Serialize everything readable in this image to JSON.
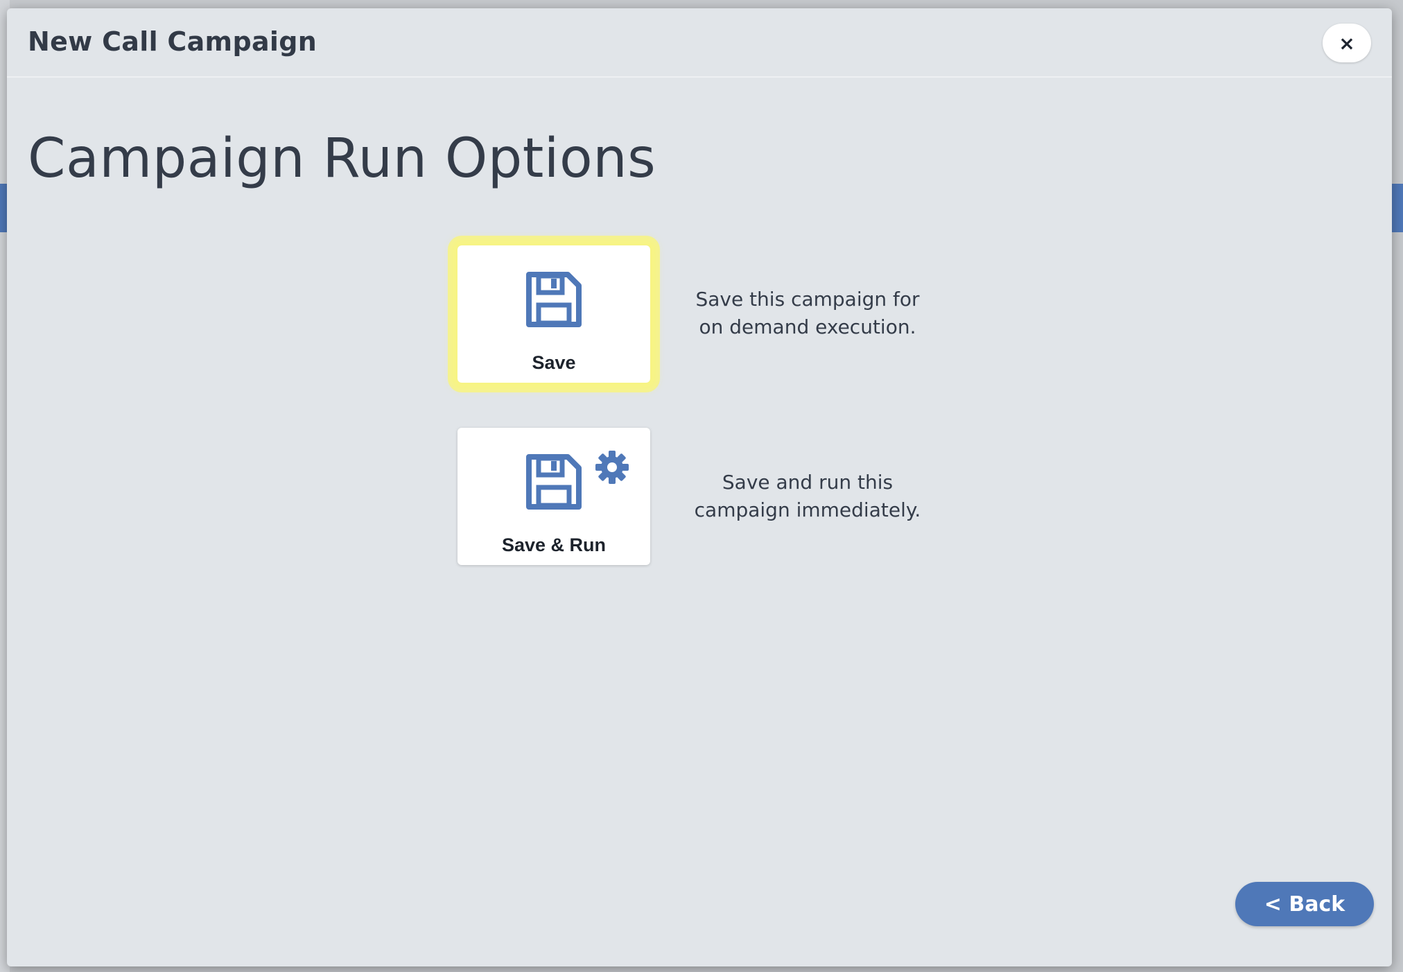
{
  "modal": {
    "title": "New Call Campaign",
    "close_label": "×"
  },
  "page": {
    "heading": "Campaign Run Options"
  },
  "options": [
    {
      "label": "Save",
      "icon": "floppy-disk-icon",
      "description_line1": "Save this campaign for",
      "description_line2": "on demand execution.",
      "highlighted": true
    },
    {
      "label": "Save & Run",
      "icon": "floppy-disk-gear-icon",
      "description_line1": "Save and run this",
      "description_line2": "campaign immediately.",
      "highlighted": false
    }
  ],
  "footer": {
    "back_label": "< Back"
  },
  "colors": {
    "accent": "#4f78b8",
    "highlight": "#faf578",
    "modal_background": "#e1e5e9",
    "text_dark": "#343c49"
  }
}
